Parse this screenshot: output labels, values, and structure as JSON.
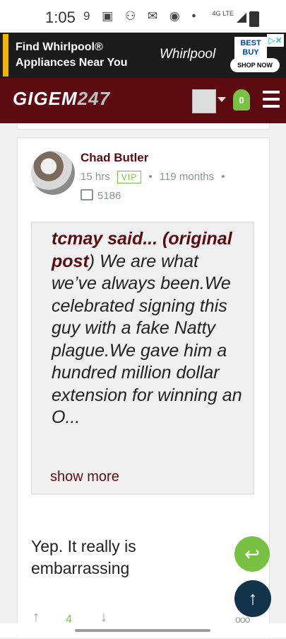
{
  "status": {
    "time": "1:05",
    "network": "4G LTE"
  },
  "ad": {
    "line1": "Find Whirlpool®",
    "line2": "Appliances Near You",
    "brand": "Whirlpool",
    "retailer": "BEST BUY",
    "cta": "SHOP NOW",
    "adchoices": "▷✕"
  },
  "header": {
    "logo_text": "GIGEM",
    "logo_num": "247",
    "notifications": "0"
  },
  "post": {
    "author": "Chad Butler",
    "time": "15 hrs",
    "badge": "VIP",
    "tenure": "119 months",
    "post_count": "5186",
    "quote": {
      "author_label": "tcmay said...",
      "link_label": "(original post",
      "text": ") We are what we’ve always been.We celebrated signing this guy with a fake Natty plague.We gave him a hundred million dollar extension for winning an O...",
      "show_more": "show more"
    },
    "body": "Yep. It really is embarrassing",
    "votes": "4"
  }
}
